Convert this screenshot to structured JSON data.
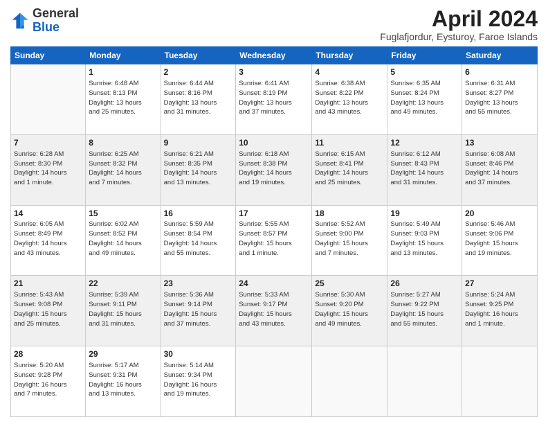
{
  "header": {
    "logo_general": "General",
    "logo_blue": "Blue",
    "month_title": "April 2024",
    "location": "Fuglafjordur, Eysturoy, Faroe Islands"
  },
  "weekdays": [
    "Sunday",
    "Monday",
    "Tuesday",
    "Wednesday",
    "Thursday",
    "Friday",
    "Saturday"
  ],
  "weeks": [
    [
      {
        "day": "",
        "info": ""
      },
      {
        "day": "1",
        "info": "Sunrise: 6:48 AM\nSunset: 8:13 PM\nDaylight: 13 hours\nand 25 minutes."
      },
      {
        "day": "2",
        "info": "Sunrise: 6:44 AM\nSunset: 8:16 PM\nDaylight: 13 hours\nand 31 minutes."
      },
      {
        "day": "3",
        "info": "Sunrise: 6:41 AM\nSunset: 8:19 PM\nDaylight: 13 hours\nand 37 minutes."
      },
      {
        "day": "4",
        "info": "Sunrise: 6:38 AM\nSunset: 8:22 PM\nDaylight: 13 hours\nand 43 minutes."
      },
      {
        "day": "5",
        "info": "Sunrise: 6:35 AM\nSunset: 8:24 PM\nDaylight: 13 hours\nand 49 minutes."
      },
      {
        "day": "6",
        "info": "Sunrise: 6:31 AM\nSunset: 8:27 PM\nDaylight: 13 hours\nand 55 minutes."
      }
    ],
    [
      {
        "day": "7",
        "info": "Sunrise: 6:28 AM\nSunset: 8:30 PM\nDaylight: 14 hours\nand 1 minute."
      },
      {
        "day": "8",
        "info": "Sunrise: 6:25 AM\nSunset: 8:32 PM\nDaylight: 14 hours\nand 7 minutes."
      },
      {
        "day": "9",
        "info": "Sunrise: 6:21 AM\nSunset: 8:35 PM\nDaylight: 14 hours\nand 13 minutes."
      },
      {
        "day": "10",
        "info": "Sunrise: 6:18 AM\nSunset: 8:38 PM\nDaylight: 14 hours\nand 19 minutes."
      },
      {
        "day": "11",
        "info": "Sunrise: 6:15 AM\nSunset: 8:41 PM\nDaylight: 14 hours\nand 25 minutes."
      },
      {
        "day": "12",
        "info": "Sunrise: 6:12 AM\nSunset: 8:43 PM\nDaylight: 14 hours\nand 31 minutes."
      },
      {
        "day": "13",
        "info": "Sunrise: 6:08 AM\nSunset: 8:46 PM\nDaylight: 14 hours\nand 37 minutes."
      }
    ],
    [
      {
        "day": "14",
        "info": "Sunrise: 6:05 AM\nSunset: 8:49 PM\nDaylight: 14 hours\nand 43 minutes."
      },
      {
        "day": "15",
        "info": "Sunrise: 6:02 AM\nSunset: 8:52 PM\nDaylight: 14 hours\nand 49 minutes."
      },
      {
        "day": "16",
        "info": "Sunrise: 5:59 AM\nSunset: 8:54 PM\nDaylight: 14 hours\nand 55 minutes."
      },
      {
        "day": "17",
        "info": "Sunrise: 5:55 AM\nSunset: 8:57 PM\nDaylight: 15 hours\nand 1 minute."
      },
      {
        "day": "18",
        "info": "Sunrise: 5:52 AM\nSunset: 9:00 PM\nDaylight: 15 hours\nand 7 minutes."
      },
      {
        "day": "19",
        "info": "Sunrise: 5:49 AM\nSunset: 9:03 PM\nDaylight: 15 hours\nand 13 minutes."
      },
      {
        "day": "20",
        "info": "Sunrise: 5:46 AM\nSunset: 9:06 PM\nDaylight: 15 hours\nand 19 minutes."
      }
    ],
    [
      {
        "day": "21",
        "info": "Sunrise: 5:43 AM\nSunset: 9:08 PM\nDaylight: 15 hours\nand 25 minutes."
      },
      {
        "day": "22",
        "info": "Sunrise: 5:39 AM\nSunset: 9:11 PM\nDaylight: 15 hours\nand 31 minutes."
      },
      {
        "day": "23",
        "info": "Sunrise: 5:36 AM\nSunset: 9:14 PM\nDaylight: 15 hours\nand 37 minutes."
      },
      {
        "day": "24",
        "info": "Sunrise: 5:33 AM\nSunset: 9:17 PM\nDaylight: 15 hours\nand 43 minutes."
      },
      {
        "day": "25",
        "info": "Sunrise: 5:30 AM\nSunset: 9:20 PM\nDaylight: 15 hours\nand 49 minutes."
      },
      {
        "day": "26",
        "info": "Sunrise: 5:27 AM\nSunset: 9:22 PM\nDaylight: 15 hours\nand 55 minutes."
      },
      {
        "day": "27",
        "info": "Sunrise: 5:24 AM\nSunset: 9:25 PM\nDaylight: 16 hours\nand 1 minute."
      }
    ],
    [
      {
        "day": "28",
        "info": "Sunrise: 5:20 AM\nSunset: 9:28 PM\nDaylight: 16 hours\nand 7 minutes."
      },
      {
        "day": "29",
        "info": "Sunrise: 5:17 AM\nSunset: 9:31 PM\nDaylight: 16 hours\nand 13 minutes."
      },
      {
        "day": "30",
        "info": "Sunrise: 5:14 AM\nSunset: 9:34 PM\nDaylight: 16 hours\nand 19 minutes."
      },
      {
        "day": "",
        "info": ""
      },
      {
        "day": "",
        "info": ""
      },
      {
        "day": "",
        "info": ""
      },
      {
        "day": "",
        "info": ""
      }
    ]
  ]
}
